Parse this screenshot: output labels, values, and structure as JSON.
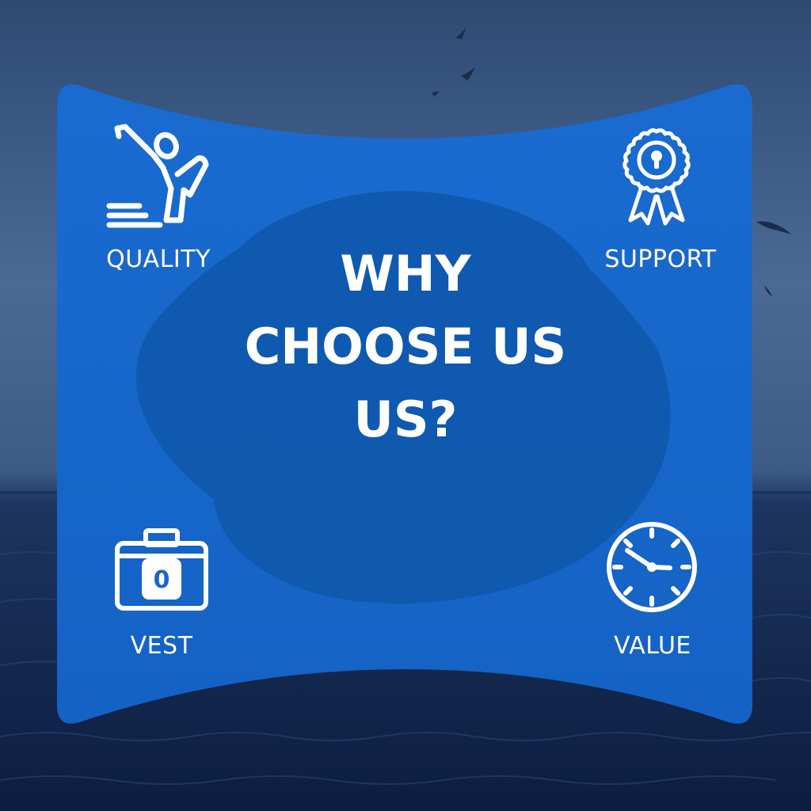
{
  "headline": {
    "line1": "WHY",
    "line2": "CHOOSE US",
    "line3": "US?"
  },
  "features": {
    "top_left": {
      "label": "QUALITY",
      "icon": "person-sliding-icon"
    },
    "top_right": {
      "label": "SUPPORT",
      "icon": "award-ribbon-icon"
    },
    "bottom_left": {
      "label": "VEST",
      "icon": "briefcase-icon"
    },
    "bottom_right": {
      "label": "VALUE",
      "icon": "clock-icon"
    }
  },
  "colors": {
    "panel": "#1767c9",
    "blob": "#0f57ad",
    "sky": "#3a5c86",
    "sea": "#10244a",
    "text": "#ffffff"
  }
}
